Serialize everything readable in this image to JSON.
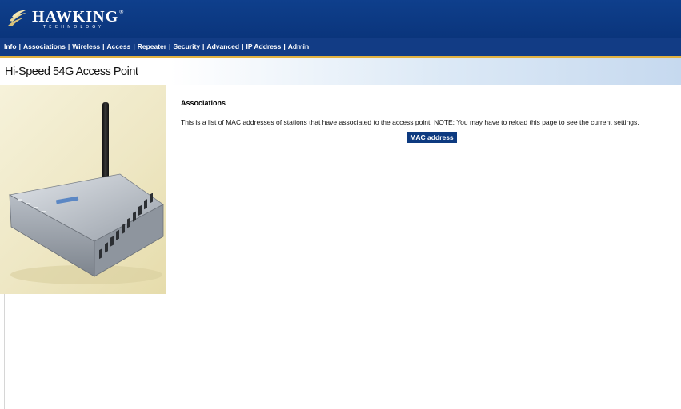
{
  "brand": {
    "name": "HAWKING",
    "registered": "®",
    "tagline": "TECHNOLOGY"
  },
  "nav": {
    "items": [
      {
        "label": "Info"
      },
      {
        "label": "Associations"
      },
      {
        "label": "Wireless"
      },
      {
        "label": "Access"
      },
      {
        "label": "Repeater"
      },
      {
        "label": "Security"
      },
      {
        "label": "Advanced"
      },
      {
        "label": "IP Address"
      },
      {
        "label": "Admin"
      }
    ],
    "separator": "|"
  },
  "page": {
    "title": "Hi-Speed 54G Access Point"
  },
  "main": {
    "heading": "Associations",
    "description": "This is a list of MAC addresses of stations that have associated to the access point. NOTE: You may have to reload this page to see the current settings.",
    "table": {
      "columns": [
        "MAC address"
      ],
      "rows": []
    }
  },
  "colors": {
    "header_blue": "#0f3f8c",
    "nav_blue": "#123c85",
    "accent_gold": "#e3b341",
    "table_header": "#0d3a80"
  },
  "icons": {
    "logo": "hawking-bird-logo",
    "product": "wireless-access-point-image"
  }
}
